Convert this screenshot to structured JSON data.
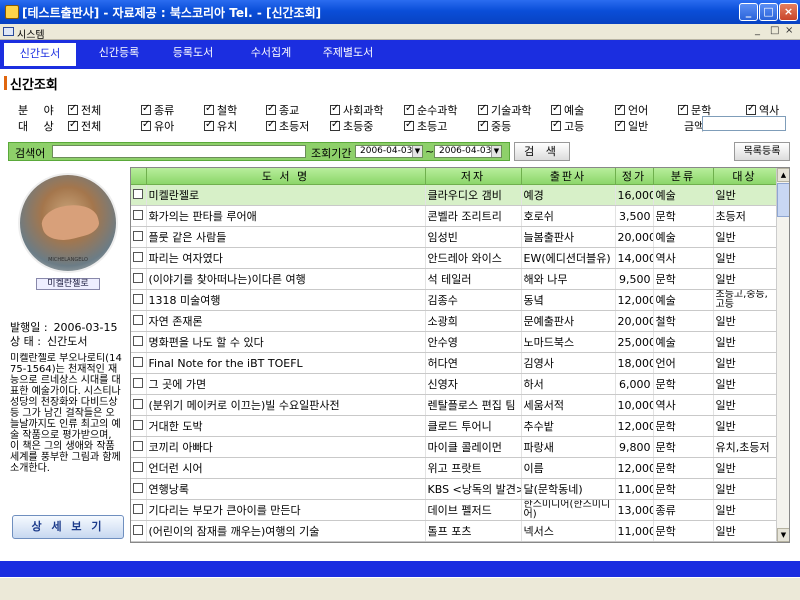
{
  "window": {
    "title": "[테스트출판사] - 자료제공 : 북스코리아  Tel. - [신간조회]"
  },
  "menubar": {
    "label": "시스템",
    "mdi_buttons": [
      "_",
      "□",
      "×"
    ]
  },
  "nav": {
    "tabs": [
      "신간도서",
      "신간등록",
      "등록도서",
      "수서집계",
      "주제별도서"
    ],
    "active": 0
  },
  "section": {
    "title": "신간조회"
  },
  "filters": {
    "field_label": "분 야",
    "fields": [
      "전체",
      "종류",
      "철학",
      "종교",
      "사회과학",
      "순수과학",
      "기술과학",
      "예술",
      "언어",
      "문학",
      "역사"
    ],
    "target_label": "대 상",
    "targets": [
      "전체",
      "유아",
      "유치",
      "초등저",
      "초등중",
      "초등고",
      "중등",
      "고등",
      "일반"
    ],
    "price_label": "금액",
    "price_value": ""
  },
  "search": {
    "keyword_label": "검색어",
    "keyword_value": "",
    "period_label": "조회기간",
    "date_from": "2006-04-03",
    "date_to": "2006-04-03",
    "date_sep": "~",
    "search_button": "검 색",
    "list_add_button": "목록등록"
  },
  "left_panel": {
    "cover_title": "미켈란젤로",
    "cover_caption": "MICHELANGELO",
    "issue_date_label": "발행일 :",
    "issue_date": "2006-03-15",
    "status_label": "상  태 :",
    "status": "신간도서",
    "description": "미켈란젤로 부오나로티(1475-1564)는 천재적인 재능으로 르네상스 시대를 대표한 예술가이다. 시스티나 성당의 천장화와 다비드상 등 그가 남긴 걸작들은 오늘날까지도 인류 최고의 예술 작품으로 평가받으며, 이 책은 그의 생애와 작품 세계를 풍부한 그림과 함께 소개한다.",
    "detail_button": "상 세 보 기"
  },
  "table": {
    "headers": [
      "",
      "도 서 명",
      "저자",
      "출판사",
      "정가",
      "분류",
      "대상"
    ],
    "rows": [
      {
        "title": "미켈란젤로",
        "author": "클라우디오 갬비",
        "publisher": "예경",
        "price": "16,000",
        "category": "예술",
        "target": "일반"
      },
      {
        "title": "화가의는 판타를 루어애",
        "author": "콘벨라 조리트리",
        "publisher": "호로쉬",
        "price": "3,500",
        "category": "문학",
        "target": "초등저"
      },
      {
        "title": "플룻 같은 사람들",
        "author": "임성빈",
        "publisher": "늘봄출판사",
        "price": "20,000",
        "category": "예술",
        "target": "일반"
      },
      {
        "title": "파리는 여자였다",
        "author": "안드레아 와이스",
        "publisher": "ΕW(에디션더블유)",
        "price": "14,000",
        "category": "역사",
        "target": "일반"
      },
      {
        "title": "(이야기를 찾아떠나는)이다른 여행",
        "author": "석 테일러",
        "publisher": "해와 나무",
        "price": "9,500",
        "category": "문학",
        "target": "일반"
      },
      {
        "title": "1318 미술여행",
        "author": "김종수",
        "publisher": "동녘",
        "price": "12,000",
        "category": "예술",
        "target": "초등고,중등,고등"
      },
      {
        "title": "자연 존재론",
        "author": "소광희",
        "publisher": "문예출판사",
        "price": "20,000",
        "category": "철학",
        "target": "일반"
      },
      {
        "title": "명화편을 나도 할 수 있다",
        "author": "안수영",
        "publisher": "노마드북스",
        "price": "25,000",
        "category": "예술",
        "target": "일반"
      },
      {
        "title": "Final Note for the iBT TOEFL",
        "author": "허다연",
        "publisher": "김영사",
        "price": "18,000",
        "category": "언어",
        "target": "일반"
      },
      {
        "title": "그 곳에 가면",
        "author": "신영자",
        "publisher": "하서",
        "price": "6,000",
        "category": "문학",
        "target": "일반"
      },
      {
        "title": "(분위기 메이커로 이끄는)빌 수요일판사전",
        "author": "렌탈플로스 편집 팀",
        "publisher": "세움서적",
        "price": "10,000",
        "category": "역사",
        "target": "일반"
      },
      {
        "title": "거대한 도박",
        "author": "클로드 투어니",
        "publisher": "추수밭",
        "price": "12,000",
        "category": "문학",
        "target": "일반"
      },
      {
        "title": "코끼리 아빠다",
        "author": "마이클 콜레이먼",
        "publisher": "파랑새",
        "price": "9,800",
        "category": "문학",
        "target": "유치,초등저"
      },
      {
        "title": "언더런 시어",
        "author": "위고 프랏트",
        "publisher": "이름",
        "price": "12,000",
        "category": "문학",
        "target": "일반"
      },
      {
        "title": "연행낭록",
        "author": "KBS <낭독의 발견>",
        "publisher": "달(문학동네)",
        "price": "11,000",
        "category": "문학",
        "target": "일반"
      },
      {
        "title": "기다리는 부모가 큰아이를 만든다",
        "author": "데이브 펠저드",
        "publisher": "한스미디어(한즈미디어)",
        "price": "13,000",
        "category": "종류",
        "target": "일반"
      },
      {
        "title": "(어린이의 잠재를 깨우는)여행의 기술",
        "author": "톨프 포츠",
        "publisher": "넥서스",
        "price": "11,000",
        "category": "문학",
        "target": "일반"
      }
    ]
  }
}
